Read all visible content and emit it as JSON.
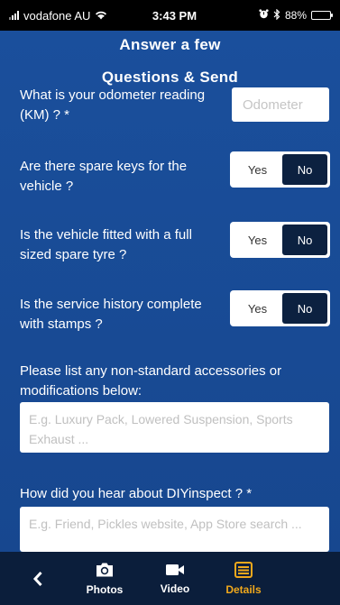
{
  "status_bar": {
    "carrier": "vodafone AU",
    "time": "3:43 PM",
    "battery": "88%",
    "battery_level": 0.88
  },
  "header": {
    "title_line1": "Answer a few",
    "title_line2": "Questions & Send"
  },
  "odometer": {
    "label": "What is your odometer reading (KM) ? *",
    "placeholder": "Odometer"
  },
  "questions": [
    {
      "label": "Are there spare keys for the vehicle ?",
      "yes": "Yes",
      "no": "No",
      "selected": "No"
    },
    {
      "label": "Is the vehicle fitted with a full sized spare tyre ?",
      "yes": "Yes",
      "no": "No",
      "selected": "No"
    },
    {
      "label": "Is the service history complete with stamps ?",
      "yes": "Yes",
      "no": "No",
      "selected": "No"
    }
  ],
  "accessories": {
    "label": "Please list any non-standard accessories or modifications below:",
    "placeholder": "E.g. Luxury Pack, Lowered Suspension, Sports Exhaust ..."
  },
  "hear_about": {
    "label": "How did you hear about DIYinspect ? *",
    "placeholder": "E.g. Friend, Pickles website, App Store search ..."
  },
  "nav": {
    "photos": "Photos",
    "video": "Video",
    "details": "Details",
    "active_color": "#f0a81c"
  }
}
